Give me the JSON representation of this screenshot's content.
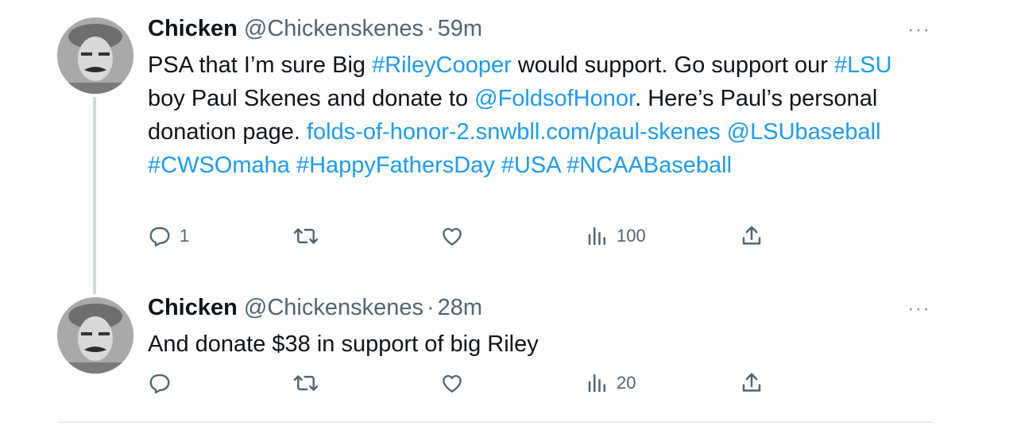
{
  "tweets": [
    {
      "name": "Chicken",
      "handle": "@Chickenskenes",
      "sep": "·",
      "time": "59m",
      "more": "···",
      "body": [
        {
          "t": "PSA that I’m sure Big ",
          "link": false
        },
        {
          "t": "#RileyCooper",
          "link": true
        },
        {
          "t": " would support. Go support our ",
          "link": false
        },
        {
          "t": "#LSU",
          "link": true
        },
        {
          "t": " boy Paul Skenes and donate to ",
          "link": false
        },
        {
          "t": "@FoldsofHonor",
          "link": true
        },
        {
          "t": ". Here’s Paul’s personal donation page. ",
          "link": false
        },
        {
          "t": "folds-of-honor-2.snwbll.com/paul-skenes",
          "link": true
        },
        {
          "t": " ",
          "link": false
        },
        {
          "t": "@LSUbaseball",
          "link": true
        },
        {
          "t": " ",
          "link": false
        },
        {
          "t": "#CWSOmaha",
          "link": true
        },
        {
          "t": " ",
          "link": false
        },
        {
          "t": "#HappyFathersDay",
          "link": true
        },
        {
          "t": " ",
          "link": false
        },
        {
          "t": "#USA",
          "link": true
        },
        {
          "t": " ",
          "link": false
        },
        {
          "t": "#NCAABaseball",
          "link": true
        }
      ],
      "replies": "1",
      "retweets": "",
      "likes": "",
      "views": "100"
    },
    {
      "name": "Chicken",
      "handle": "@Chickenskenes",
      "sep": "·",
      "time": "28m",
      "more": "···",
      "body": [
        {
          "t": "And donate $38 in support of big Riley",
          "link": false
        }
      ],
      "replies": "",
      "retweets": "",
      "likes": "",
      "views": "20"
    }
  ],
  "colors": {
    "link": "#1d9bf0",
    "text": "#0f1419",
    "muted": "#536471"
  }
}
